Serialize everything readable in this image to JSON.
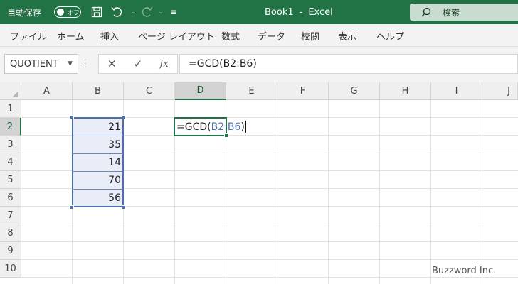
{
  "titlebar": {
    "autosave_label": "自動保存",
    "autosave_state": "オフ",
    "doc_title": "Book1",
    "app_name": "Excel",
    "title_sep": "-",
    "search_placeholder": "検索",
    "bg_color": "#217346",
    "icons": [
      "save-icon",
      "undo-icon",
      "redo-icon",
      "customize-qat-icon"
    ]
  },
  "ribbon": {
    "tabs": [
      "ファイル",
      "ホーム",
      "挿入",
      "ページ レイアウト",
      "数式",
      "データ",
      "校閲",
      "表示",
      "ヘルプ"
    ]
  },
  "formula_bar": {
    "name_box": "QUOTIENT",
    "cancel_icon": "✕",
    "enter_icon": "✓",
    "fx_label": "fx",
    "formula": "=GCD(B2:B6)"
  },
  "sheet": {
    "columns": [
      "A",
      "B",
      "C",
      "D",
      "E",
      "F",
      "G",
      "H",
      "I",
      "J"
    ],
    "rows": [
      "1",
      "2",
      "3",
      "4",
      "5",
      "6",
      "7",
      "8",
      "9",
      "10"
    ],
    "active_cell": "D2",
    "selected_range": "B2:B6",
    "values_B": [
      "21",
      "35",
      "14",
      "70",
      "56"
    ],
    "edit": {
      "prefix": "=GCD(",
      "ref": "B2:B6",
      "suffix": ")"
    },
    "accent_color": "#217346",
    "range_color": "#4d6fae"
  },
  "watermark": "Buzzword Inc."
}
